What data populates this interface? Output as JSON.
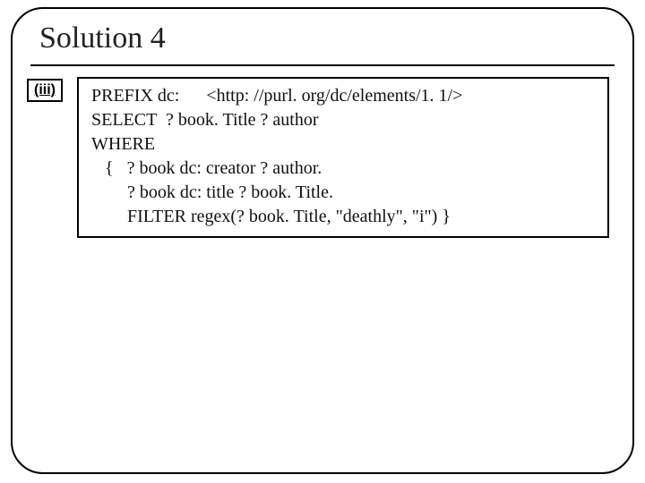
{
  "title": "Solution 4",
  "label": "(iii)",
  "code": {
    "l1": "PREFIX dc:      <http: //purl. org/dc/elements/1. 1/>",
    "l2": "SELECT  ? book. Title ? author",
    "l3": "WHERE",
    "l4": "   {   ? book dc: creator ? author.",
    "l5": "        ? book dc: title ? book. Title.",
    "l6": "        FILTER regex(? book. Title, \"deathly\", \"i\") }"
  }
}
